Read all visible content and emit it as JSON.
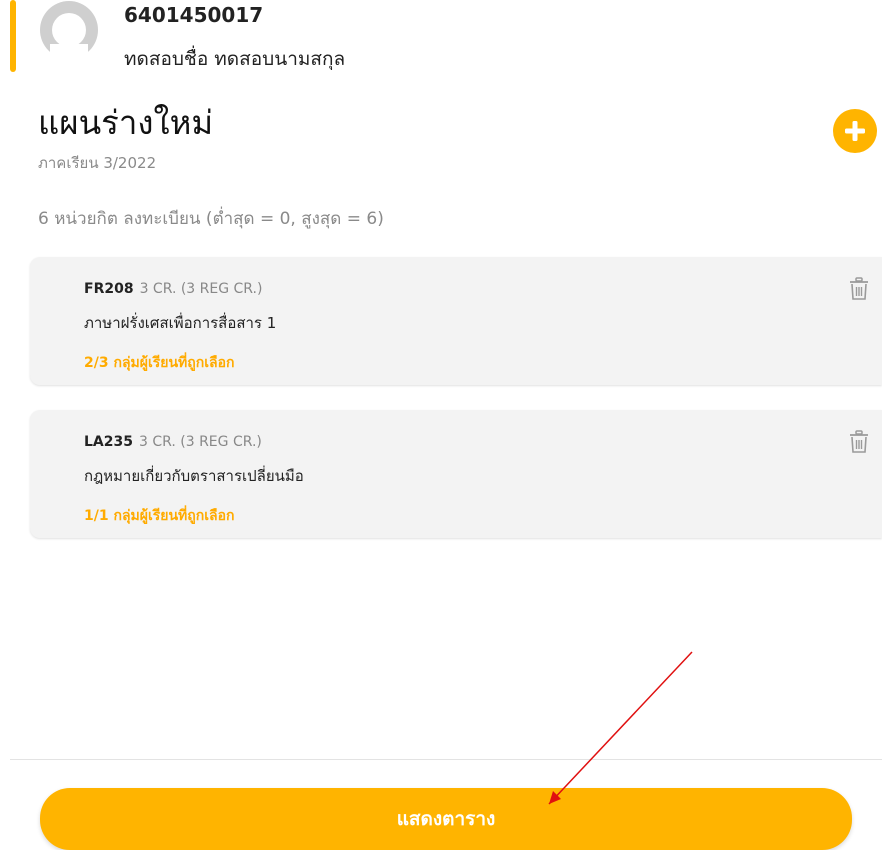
{
  "student": {
    "id": "6401450017",
    "name": "ทดสอบชื่อ ทดสอบนามสกุล"
  },
  "plan": {
    "title": "แผนร่างใหม่",
    "semester": "ภาคเรียน 3/2022",
    "credit_summary": "6 หน่วยกิต ลงทะเบียน (ต่ำสุด = 0, สูงสุด = 6)"
  },
  "courses": [
    {
      "code": "FR208",
      "credits": "3 CR. (3 REG CR.)",
      "name": "ภาษาฝรั่งเศสเพื่อการสื่อสาร 1",
      "groups": "2/3 กลุ่มผู้เรียนที่ถูกเลือก"
    },
    {
      "code": "LA235",
      "credits": "3 CR. (3 REG CR.)",
      "name": "กฎหมายเกี่ยวกับตราสารเปลี่ยนมือ",
      "groups": "1/1 กลุ่มผู้เรียนที่ถูกเลือก"
    }
  ],
  "footer": {
    "show_schedule_label": "แสดงตาราง"
  },
  "colors": {
    "accent": "#ffb400",
    "annotation_arrow": "#e01010"
  },
  "icons": [
    "avatar-placeholder-icon",
    "plus-icon",
    "trash-icon"
  ]
}
